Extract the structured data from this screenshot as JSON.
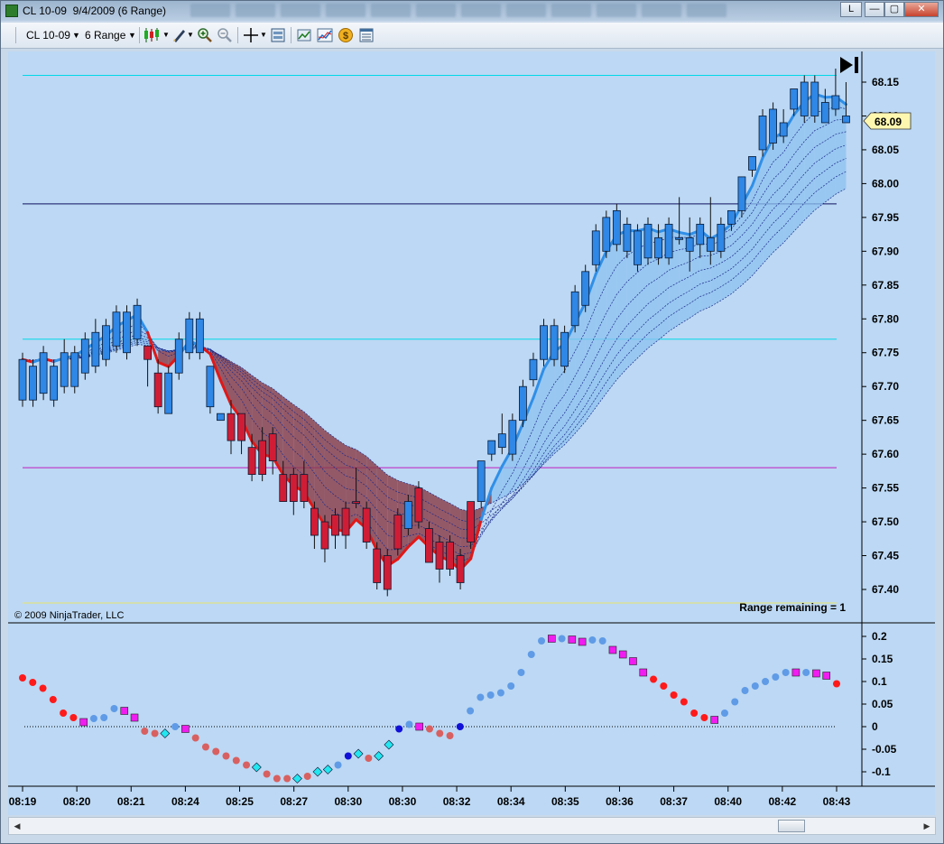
{
  "window": {
    "title": "CL 10-09  9/4/2009 (6 Range)",
    "buttons": {
      "pin": "L",
      "minimize": "—",
      "maximize": "▢",
      "close": "✕"
    }
  },
  "toolbar": {
    "instrument": "CL 10-09",
    "interval": "6 Range",
    "icons": [
      "candlestick-style-icon",
      "drawing-tool-icon",
      "zoom-in-icon",
      "zoom-out-icon",
      "crosshair-icon",
      "data-box-icon",
      "indicators-icon",
      "strategies-icon",
      "order-icon",
      "properties-icon"
    ]
  },
  "colors": {
    "background": "#bcd8f4",
    "upCandle": "#2f87e6",
    "downCandle": "#d01d35",
    "cyanLine": "#00d8e8",
    "magentaLine": "#c01cc0",
    "navyLine": "#101060",
    "yellowLine": "#e7e36a"
  },
  "price_panel": {
    "copyright": "© 2009 NinjaTrader, LLC",
    "range_remaining": "Range remaining = 1",
    "current_price": "68.09",
    "price_axis": [
      "68.15",
      "68.10",
      "68.05",
      "68.00",
      "67.95",
      "67.90",
      "67.85",
      "67.80",
      "67.75",
      "67.70",
      "67.65",
      "67.60",
      "67.55",
      "67.50",
      "67.45",
      "67.40"
    ],
    "horizontal_lines": [
      {
        "price": 68.16,
        "color": "cyan"
      },
      {
        "price": 67.97,
        "color": "navy"
      },
      {
        "price": 67.77,
        "color": "cyan"
      },
      {
        "price": 67.58,
        "color": "magenta"
      },
      {
        "price": 67.38,
        "color": "yellow"
      }
    ]
  },
  "oscillator_panel": {
    "axis": [
      "0.2",
      "0.15",
      "0.1",
      "0.05",
      "0",
      "-0.05",
      "-0.1"
    ]
  },
  "time_axis": [
    "08:19",
    "08:20",
    "08:21",
    "08:24",
    "08:25",
    "08:27",
    "08:30",
    "08:30",
    "08:32",
    "08:34",
    "08:35",
    "08:36",
    "08:37",
    "08:40",
    "08:42",
    "08:43"
  ],
  "chart_data": {
    "type": "candlestick",
    "ylim": [
      67.37,
      68.19
    ],
    "candles": [
      {
        "o": 67.68,
        "c": 67.74,
        "h": 67.75,
        "l": 67.67,
        "dir": "up"
      },
      {
        "o": 67.68,
        "c": 67.73,
        "h": 67.74,
        "l": 67.67,
        "dir": "up"
      },
      {
        "o": 67.69,
        "c": 67.75,
        "h": 67.76,
        "l": 67.68,
        "dir": "up"
      },
      {
        "o": 67.68,
        "c": 67.73,
        "h": 67.74,
        "l": 67.67,
        "dir": "up"
      },
      {
        "o": 67.7,
        "c": 67.75,
        "h": 67.77,
        "l": 67.69,
        "dir": "up"
      },
      {
        "o": 67.7,
        "c": 67.75,
        "h": 67.76,
        "l": 67.69,
        "dir": "up"
      },
      {
        "o": 67.72,
        "c": 67.77,
        "h": 67.78,
        "l": 67.71,
        "dir": "up"
      },
      {
        "o": 67.73,
        "c": 67.78,
        "h": 67.8,
        "l": 67.72,
        "dir": "up"
      },
      {
        "o": 67.74,
        "c": 67.79,
        "h": 67.8,
        "l": 67.73,
        "dir": "up"
      },
      {
        "o": 67.76,
        "c": 67.81,
        "h": 67.82,
        "l": 67.75,
        "dir": "up"
      },
      {
        "o": 67.75,
        "c": 67.81,
        "h": 67.82,
        "l": 67.74,
        "dir": "up"
      },
      {
        "o": 67.77,
        "c": 67.82,
        "h": 67.83,
        "l": 67.76,
        "dir": "up"
      },
      {
        "o": 67.76,
        "c": 67.74,
        "h": 67.76,
        "l": 67.7,
        "dir": "down"
      },
      {
        "o": 67.72,
        "c": 67.67,
        "h": 67.74,
        "l": 67.66,
        "dir": "down"
      },
      {
        "o": 67.66,
        "c": 67.72,
        "h": 67.73,
        "l": 67.66,
        "dir": "up"
      },
      {
        "o": 67.72,
        "c": 67.77,
        "h": 67.78,
        "l": 67.71,
        "dir": "up"
      },
      {
        "o": 67.75,
        "c": 67.8,
        "h": 67.81,
        "l": 67.74,
        "dir": "up"
      },
      {
        "o": 67.8,
        "c": 67.75,
        "h": 67.81,
        "l": 67.74,
        "dir": "up"
      },
      {
        "o": 67.67,
        "c": 67.73,
        "h": 67.73,
        "l": 67.66,
        "dir": "up"
      },
      {
        "o": 67.66,
        "c": 67.65,
        "h": 67.66,
        "l": 67.65,
        "dir": "up"
      },
      {
        "o": 67.66,
        "c": 67.62,
        "h": 67.68,
        "l": 67.6,
        "dir": "down"
      },
      {
        "o": 67.66,
        "c": 67.62,
        "h": 67.66,
        "l": 67.6,
        "dir": "down"
      },
      {
        "o": 67.61,
        "c": 67.57,
        "h": 67.63,
        "l": 67.56,
        "dir": "down"
      },
      {
        "o": 67.62,
        "c": 67.57,
        "h": 67.64,
        "l": 67.56,
        "dir": "down"
      },
      {
        "o": 67.63,
        "c": 67.59,
        "h": 67.64,
        "l": 67.57,
        "dir": "down"
      },
      {
        "o": 67.57,
        "c": 67.53,
        "h": 67.59,
        "l": 67.53,
        "dir": "down"
      },
      {
        "o": 67.57,
        "c": 67.53,
        "h": 67.58,
        "l": 67.51,
        "dir": "down"
      },
      {
        "o": 67.57,
        "c": 67.53,
        "h": 67.59,
        "l": 67.52,
        "dir": "down"
      },
      {
        "o": 67.52,
        "c": 67.48,
        "h": 67.53,
        "l": 67.46,
        "dir": "down"
      },
      {
        "o": 67.5,
        "c": 67.46,
        "h": 67.51,
        "l": 67.44,
        "dir": "down"
      },
      {
        "o": 67.51,
        "c": 67.48,
        "h": 67.52,
        "l": 67.46,
        "dir": "down"
      },
      {
        "o": 67.52,
        "c": 67.48,
        "h": 67.53,
        "l": 67.46,
        "dir": "down"
      },
      {
        "o": 67.53,
        "c": 67.53,
        "h": 67.58,
        "l": 67.52,
        "dir": "down"
      },
      {
        "o": 67.52,
        "c": 67.47,
        "h": 67.53,
        "l": 67.46,
        "dir": "down"
      },
      {
        "o": 67.46,
        "c": 67.41,
        "h": 67.47,
        "l": 67.4,
        "dir": "down"
      },
      {
        "o": 67.45,
        "c": 67.4,
        "h": 67.46,
        "l": 67.39,
        "dir": "down"
      },
      {
        "o": 67.51,
        "c": 67.46,
        "h": 67.52,
        "l": 67.45,
        "dir": "down"
      },
      {
        "o": 67.53,
        "c": 67.49,
        "h": 67.54,
        "l": 67.48,
        "dir": "up"
      },
      {
        "o": 67.55,
        "c": 67.5,
        "h": 67.56,
        "l": 67.49,
        "dir": "down"
      },
      {
        "o": 67.49,
        "c": 67.44,
        "h": 67.5,
        "l": 67.44,
        "dir": "down"
      },
      {
        "o": 67.47,
        "c": 67.43,
        "h": 67.48,
        "l": 67.41,
        "dir": "down"
      },
      {
        "o": 67.47,
        "c": 67.43,
        "h": 67.48,
        "l": 67.42,
        "dir": "down"
      },
      {
        "o": 67.45,
        "c": 67.41,
        "h": 67.46,
        "l": 67.4,
        "dir": "down"
      },
      {
        "o": 67.53,
        "c": 67.47,
        "h": 67.53,
        "l": 67.46,
        "dir": "down"
      },
      {
        "o": 67.53,
        "c": 67.59,
        "h": 67.59,
        "l": 67.52,
        "dir": "up"
      },
      {
        "o": 67.6,
        "c": 67.62,
        "h": 67.62,
        "l": 67.59,
        "dir": "up"
      },
      {
        "o": 67.61,
        "c": 67.63,
        "h": 67.66,
        "l": 67.6,
        "dir": "up"
      },
      {
        "o": 67.6,
        "c": 67.65,
        "h": 67.66,
        "l": 67.59,
        "dir": "up"
      },
      {
        "o": 67.65,
        "c": 67.7,
        "h": 67.71,
        "l": 67.64,
        "dir": "up"
      },
      {
        "o": 67.71,
        "c": 67.74,
        "h": 67.75,
        "l": 67.7,
        "dir": "up"
      },
      {
        "o": 67.74,
        "c": 67.79,
        "h": 67.8,
        "l": 67.73,
        "dir": "up"
      },
      {
        "o": 67.74,
        "c": 67.79,
        "h": 67.8,
        "l": 67.73,
        "dir": "up"
      },
      {
        "o": 67.73,
        "c": 67.78,
        "h": 67.79,
        "l": 67.72,
        "dir": "up"
      },
      {
        "o": 67.79,
        "c": 67.84,
        "h": 67.85,
        "l": 67.78,
        "dir": "up"
      },
      {
        "o": 67.82,
        "c": 67.87,
        "h": 67.88,
        "l": 67.81,
        "dir": "up"
      },
      {
        "o": 67.88,
        "c": 67.93,
        "h": 67.94,
        "l": 67.87,
        "dir": "up"
      },
      {
        "o": 67.9,
        "c": 67.95,
        "h": 67.96,
        "l": 67.89,
        "dir": "up"
      },
      {
        "o": 67.91,
        "c": 67.96,
        "h": 67.97,
        "l": 67.9,
        "dir": "up"
      },
      {
        "o": 67.9,
        "c": 67.94,
        "h": 67.95,
        "l": 67.89,
        "dir": "up"
      },
      {
        "o": 67.88,
        "c": 67.93,
        "h": 67.94,
        "l": 67.87,
        "dir": "up"
      },
      {
        "o": 67.89,
        "c": 67.94,
        "h": 67.95,
        "l": 67.88,
        "dir": "up"
      },
      {
        "o": 67.89,
        "c": 67.92,
        "h": 67.94,
        "l": 67.88,
        "dir": "up"
      },
      {
        "o": 67.89,
        "c": 67.94,
        "h": 67.95,
        "l": 67.88,
        "dir": "up"
      },
      {
        "o": 67.92,
        "c": 67.92,
        "h": 67.98,
        "l": 67.91,
        "dir": "up"
      },
      {
        "o": 67.9,
        "c": 67.92,
        "h": 67.95,
        "l": 67.87,
        "dir": "up"
      },
      {
        "o": 67.91,
        "c": 67.94,
        "h": 67.95,
        "l": 67.89,
        "dir": "up"
      },
      {
        "o": 67.92,
        "c": 67.9,
        "h": 67.98,
        "l": 67.88,
        "dir": "up"
      },
      {
        "o": 67.9,
        "c": 67.94,
        "h": 67.95,
        "l": 67.89,
        "dir": "up"
      },
      {
        "o": 67.94,
        "c": 67.96,
        "h": 67.96,
        "l": 67.93,
        "dir": "up"
      },
      {
        "o": 67.96,
        "c": 68.01,
        "h": 68.01,
        "l": 67.95,
        "dir": "up"
      },
      {
        "o": 68.02,
        "c": 68.04,
        "h": 68.04,
        "l": 68.01,
        "dir": "up"
      },
      {
        "o": 68.05,
        "c": 68.1,
        "h": 68.11,
        "l": 68.04,
        "dir": "up"
      },
      {
        "o": 68.06,
        "c": 68.11,
        "h": 68.12,
        "l": 68.05,
        "dir": "up"
      },
      {
        "o": 68.07,
        "c": 68.09,
        "h": 68.11,
        "l": 68.06,
        "dir": "up"
      },
      {
        "o": 68.11,
        "c": 68.14,
        "h": 68.14,
        "l": 68.1,
        "dir": "up"
      },
      {
        "o": 68.1,
        "c": 68.15,
        "h": 68.16,
        "l": 68.09,
        "dir": "up"
      },
      {
        "o": 68.1,
        "c": 68.15,
        "h": 68.16,
        "l": 68.09,
        "dir": "up"
      },
      {
        "o": 68.09,
        "c": 68.12,
        "h": 68.14,
        "l": 68.09,
        "dir": "up"
      },
      {
        "o": 68.11,
        "c": 68.13,
        "h": 68.17,
        "l": 68.1,
        "dir": "up"
      },
      {
        "o": 68.09,
        "c": 68.1,
        "h": 68.15,
        "l": 68.09,
        "dir": "up"
      }
    ],
    "oscillator": [
      {
        "v": 0.108,
        "c": "red"
      },
      {
        "v": 0.098,
        "c": "red"
      },
      {
        "v": 0.085,
        "c": "red"
      },
      {
        "v": 0.06,
        "c": "red"
      },
      {
        "v": 0.03,
        "c": "red"
      },
      {
        "v": 0.02,
        "c": "red"
      },
      {
        "v": 0.01,
        "c": "magenta"
      },
      {
        "v": 0.018,
        "c": "blue"
      },
      {
        "v": 0.02,
        "c": "blue"
      },
      {
        "v": 0.04,
        "c": "blue"
      },
      {
        "v": 0.035,
        "c": "magenta"
      },
      {
        "v": 0.02,
        "c": "pink"
      },
      {
        "v": -0.01,
        "c": "salmon"
      },
      {
        "v": -0.015,
        "c": "salmon"
      },
      {
        "v": -0.015,
        "c": "cyan"
      },
      {
        "v": 0.0,
        "c": "blue"
      },
      {
        "v": -0.005,
        "c": "magenta"
      },
      {
        "v": -0.025,
        "c": "salmon"
      },
      {
        "v": -0.045,
        "c": "salmon"
      },
      {
        "v": -0.055,
        "c": "salmon"
      },
      {
        "v": -0.065,
        "c": "salmon"
      },
      {
        "v": -0.075,
        "c": "salmon"
      },
      {
        "v": -0.085,
        "c": "salmon"
      },
      {
        "v": -0.09,
        "c": "cyan"
      },
      {
        "v": -0.105,
        "c": "salmon"
      },
      {
        "v": -0.115,
        "c": "salmon"
      },
      {
        "v": -0.115,
        "c": "salmon"
      },
      {
        "v": -0.115,
        "c": "cyan"
      },
      {
        "v": -0.11,
        "c": "salmon"
      },
      {
        "v": -0.1,
        "c": "cyan"
      },
      {
        "v": -0.095,
        "c": "cyan"
      },
      {
        "v": -0.085,
        "c": "blue"
      },
      {
        "v": -0.065,
        "c": "navy"
      },
      {
        "v": -0.06,
        "c": "cyan"
      },
      {
        "v": -0.07,
        "c": "salmon"
      },
      {
        "v": -0.065,
        "c": "cyan"
      },
      {
        "v": -0.04,
        "c": "cyan"
      },
      {
        "v": -0.005,
        "c": "navy"
      },
      {
        "v": 0.005,
        "c": "blue"
      },
      {
        "v": 0.0,
        "c": "magenta"
      },
      {
        "v": -0.005,
        "c": "salmon"
      },
      {
        "v": -0.015,
        "c": "salmon"
      },
      {
        "v": -0.02,
        "c": "salmon"
      },
      {
        "v": -0.0,
        "c": "navy"
      },
      {
        "v": 0.035,
        "c": "blue"
      },
      {
        "v": 0.065,
        "c": "blue"
      },
      {
        "v": 0.07,
        "c": "blue"
      },
      {
        "v": 0.075,
        "c": "blue"
      },
      {
        "v": 0.09,
        "c": "blue"
      },
      {
        "v": 0.12,
        "c": "blue"
      },
      {
        "v": 0.16,
        "c": "blue"
      },
      {
        "v": 0.19,
        "c": "blue"
      },
      {
        "v": 0.195,
        "c": "magenta"
      },
      {
        "v": 0.195,
        "c": "blue"
      },
      {
        "v": 0.193,
        "c": "magenta"
      },
      {
        "v": 0.188,
        "c": "magenta"
      },
      {
        "v": 0.192,
        "c": "blue"
      },
      {
        "v": 0.19,
        "c": "blue"
      },
      {
        "v": 0.17,
        "c": "pink"
      },
      {
        "v": 0.16,
        "c": "magenta"
      },
      {
        "v": 0.145,
        "c": "pink"
      },
      {
        "v": 0.12,
        "c": "magenta"
      },
      {
        "v": 0.105,
        "c": "red"
      },
      {
        "v": 0.09,
        "c": "red"
      },
      {
        "v": 0.07,
        "c": "red"
      },
      {
        "v": 0.055,
        "c": "red"
      },
      {
        "v": 0.03,
        "c": "red"
      },
      {
        "v": 0.02,
        "c": "red"
      },
      {
        "v": 0.015,
        "c": "magenta"
      },
      {
        "v": 0.03,
        "c": "blue"
      },
      {
        "v": 0.055,
        "c": "blue"
      },
      {
        "v": 0.08,
        "c": "blue"
      },
      {
        "v": 0.09,
        "c": "blue"
      },
      {
        "v": 0.1,
        "c": "blue"
      },
      {
        "v": 0.11,
        "c": "blue"
      },
      {
        "v": 0.12,
        "c": "blue"
      },
      {
        "v": 0.12,
        "c": "magenta"
      },
      {
        "v": 0.12,
        "c": "blue"
      },
      {
        "v": 0.118,
        "c": "magenta"
      },
      {
        "v": 0.113,
        "c": "magenta"
      },
      {
        "v": 0.095,
        "c": "red"
      }
    ]
  }
}
